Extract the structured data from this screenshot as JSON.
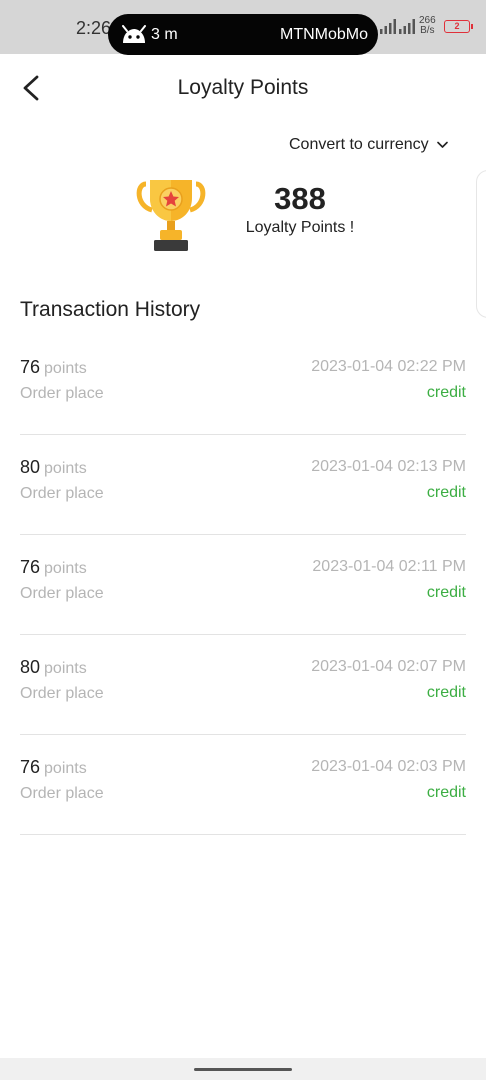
{
  "status_bar": {
    "time": "2:26",
    "notification_duration": "3 m",
    "carrier": "MTNMobMo",
    "net_speed_value": "266",
    "net_speed_unit": "B/s",
    "battery_level": "2"
  },
  "header": {
    "title": "Loyalty Points"
  },
  "convert": {
    "label": "Convert to currency"
  },
  "summary": {
    "total_points": "388",
    "caption": "Loyalty Points !"
  },
  "history": {
    "title": "Transaction History",
    "points_unit": "points",
    "items": [
      {
        "points": "76",
        "description": "Order place",
        "date": "2023-01-04 02:22 PM",
        "type": "credit"
      },
      {
        "points": "80",
        "description": "Order place",
        "date": "2023-01-04 02:13 PM",
        "type": "credit"
      },
      {
        "points": "76",
        "description": "Order place",
        "date": "2023-01-04 02:11 PM",
        "type": "credit"
      },
      {
        "points": "80",
        "description": "Order place",
        "date": "2023-01-04 02:07 PM",
        "type": "credit"
      },
      {
        "points": "76",
        "description": "Order place",
        "date": "2023-01-04 02:03 PM",
        "type": "credit"
      }
    ]
  },
  "colors": {
    "credit": "#3cae43",
    "muted_text": "#b5b5b5",
    "trophy_gold": "#f6b429",
    "trophy_star": "#e5433c"
  },
  "icons": {
    "back": "chevron-left-icon",
    "convert": "chevron-down-icon",
    "trophy": "trophy-icon"
  }
}
